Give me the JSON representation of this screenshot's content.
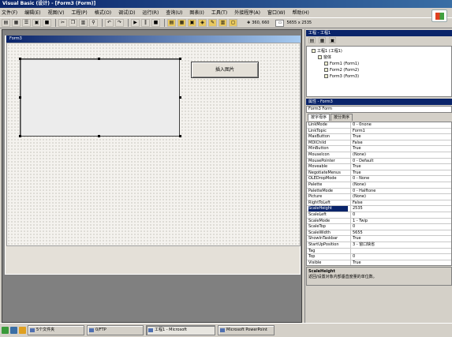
{
  "window": {
    "title": "Visual Basic (设计) - [Form3 (Form)]"
  },
  "menu": [
    "文件(F)",
    "编辑(E)",
    "视图(V)",
    "工程(P)",
    "格式(O)",
    "调试(D)",
    "运行(R)",
    "查询(U)",
    "图表(I)",
    "工具(T)",
    "外接程序(A)",
    "窗口(W)",
    "帮助(H)"
  ],
  "toolbar": {
    "position": "360, 660",
    "size": "5655 x 2535"
  },
  "form": {
    "title": "Form3",
    "command_button_label": "插入图片"
  },
  "project": {
    "title": "工程 - 工程1",
    "tree": [
      {
        "label": "工程1 (工程1)",
        "level": 0
      },
      {
        "label": "窗体",
        "level": 1
      },
      {
        "label": "Form1 (Form1)",
        "level": 2
      },
      {
        "label": "Form2 (Form2)",
        "level": 2
      },
      {
        "label": "Form3 (Form3)",
        "level": 2
      }
    ]
  },
  "properties": {
    "title": "属性 - Form3",
    "object": "Form3 Form",
    "tabs": [
      "按字母序",
      "按分类序"
    ],
    "rows": [
      {
        "k": "LinkMode",
        "v": "0 - 0none"
      },
      {
        "k": "LinkTopic",
        "v": "Form1"
      },
      {
        "k": "MaxButton",
        "v": "True"
      },
      {
        "k": "MDIChild",
        "v": "False"
      },
      {
        "k": "MinButton",
        "v": "True"
      },
      {
        "k": "MouseIcon",
        "v": "(None)"
      },
      {
        "k": "MousePointer",
        "v": "0 - Default"
      },
      {
        "k": "Moveable",
        "v": "True"
      },
      {
        "k": "NegotiateMenus",
        "v": "True"
      },
      {
        "k": "OLEDropMode",
        "v": "0 - None"
      },
      {
        "k": "Palette",
        "v": "(None)"
      },
      {
        "k": "PaletteMode",
        "v": "0 - Halftone"
      },
      {
        "k": "Picture",
        "v": "(None)"
      },
      {
        "k": "RightToLeft",
        "v": "False"
      },
      {
        "k": "ScaleHeight",
        "v": "2535"
      },
      {
        "k": "ScaleLeft",
        "v": "0"
      },
      {
        "k": "ScaleMode",
        "v": "1 - Twip"
      },
      {
        "k": "ScaleTop",
        "v": "0"
      },
      {
        "k": "ScaleWidth",
        "v": "5655"
      },
      {
        "k": "ShowInTaskbar",
        "v": "True"
      },
      {
        "k": "StartUpPosition",
        "v": "3 - 窗口缺省"
      },
      {
        "k": "Tag",
        "v": ""
      },
      {
        "k": "Top",
        "v": "0"
      },
      {
        "k": "Visible",
        "v": "True"
      }
    ],
    "selected_index": 14,
    "description_title": "ScaleHeight",
    "description_text": "返回/设置对象内部垂直度量的单位数。"
  },
  "taskbar": [
    "5个文件夹",
    "0/FTP",
    "工程1 - Microsoft",
    "Microsoft PowerPoint"
  ]
}
